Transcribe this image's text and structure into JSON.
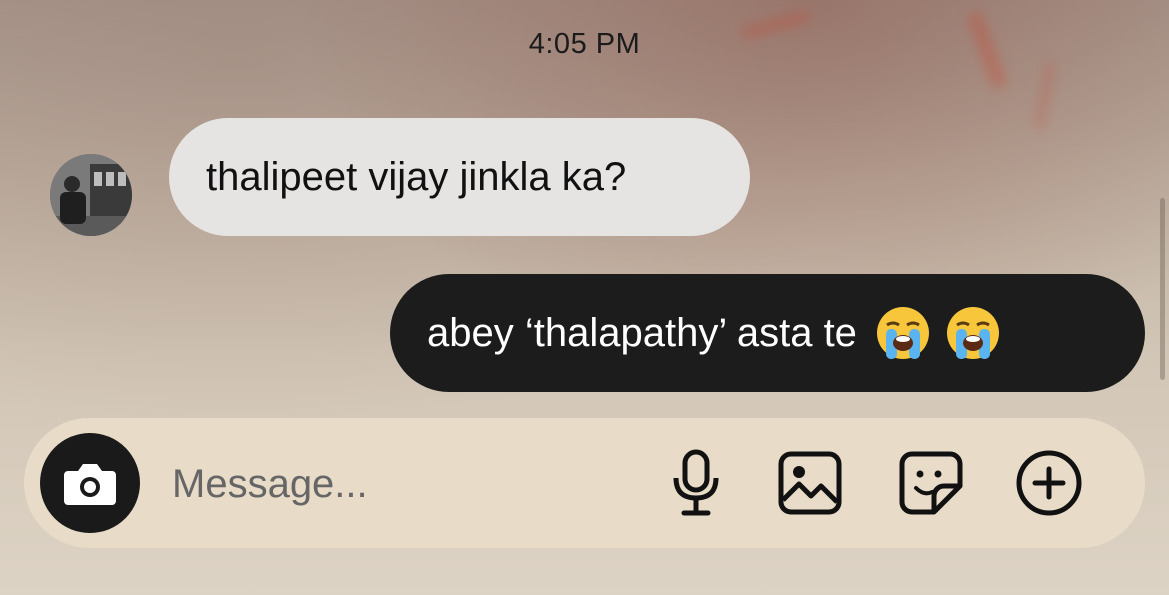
{
  "status": {
    "time": "4:05 PM"
  },
  "conversation": {
    "messages": [
      {
        "direction": "incoming",
        "text": "thalipeet vijay jinkla ka?"
      },
      {
        "direction": "outgoing",
        "text": "abey ‘thalapathy’ asta te",
        "emojis": [
          "loudly-crying-face",
          "loudly-crying-face"
        ]
      }
    ]
  },
  "composer": {
    "placeholder": "Message...",
    "value": "",
    "icons": [
      "camera-icon",
      "microphone-icon",
      "gallery-icon",
      "sticker-icon",
      "add-icon"
    ]
  },
  "colors": {
    "incoming_bubble": "#e6e4e2",
    "outgoing_bubble": "#1c1c1c",
    "composer_bg": "#e8dcc8",
    "camera_button": "#1a1a1a"
  }
}
